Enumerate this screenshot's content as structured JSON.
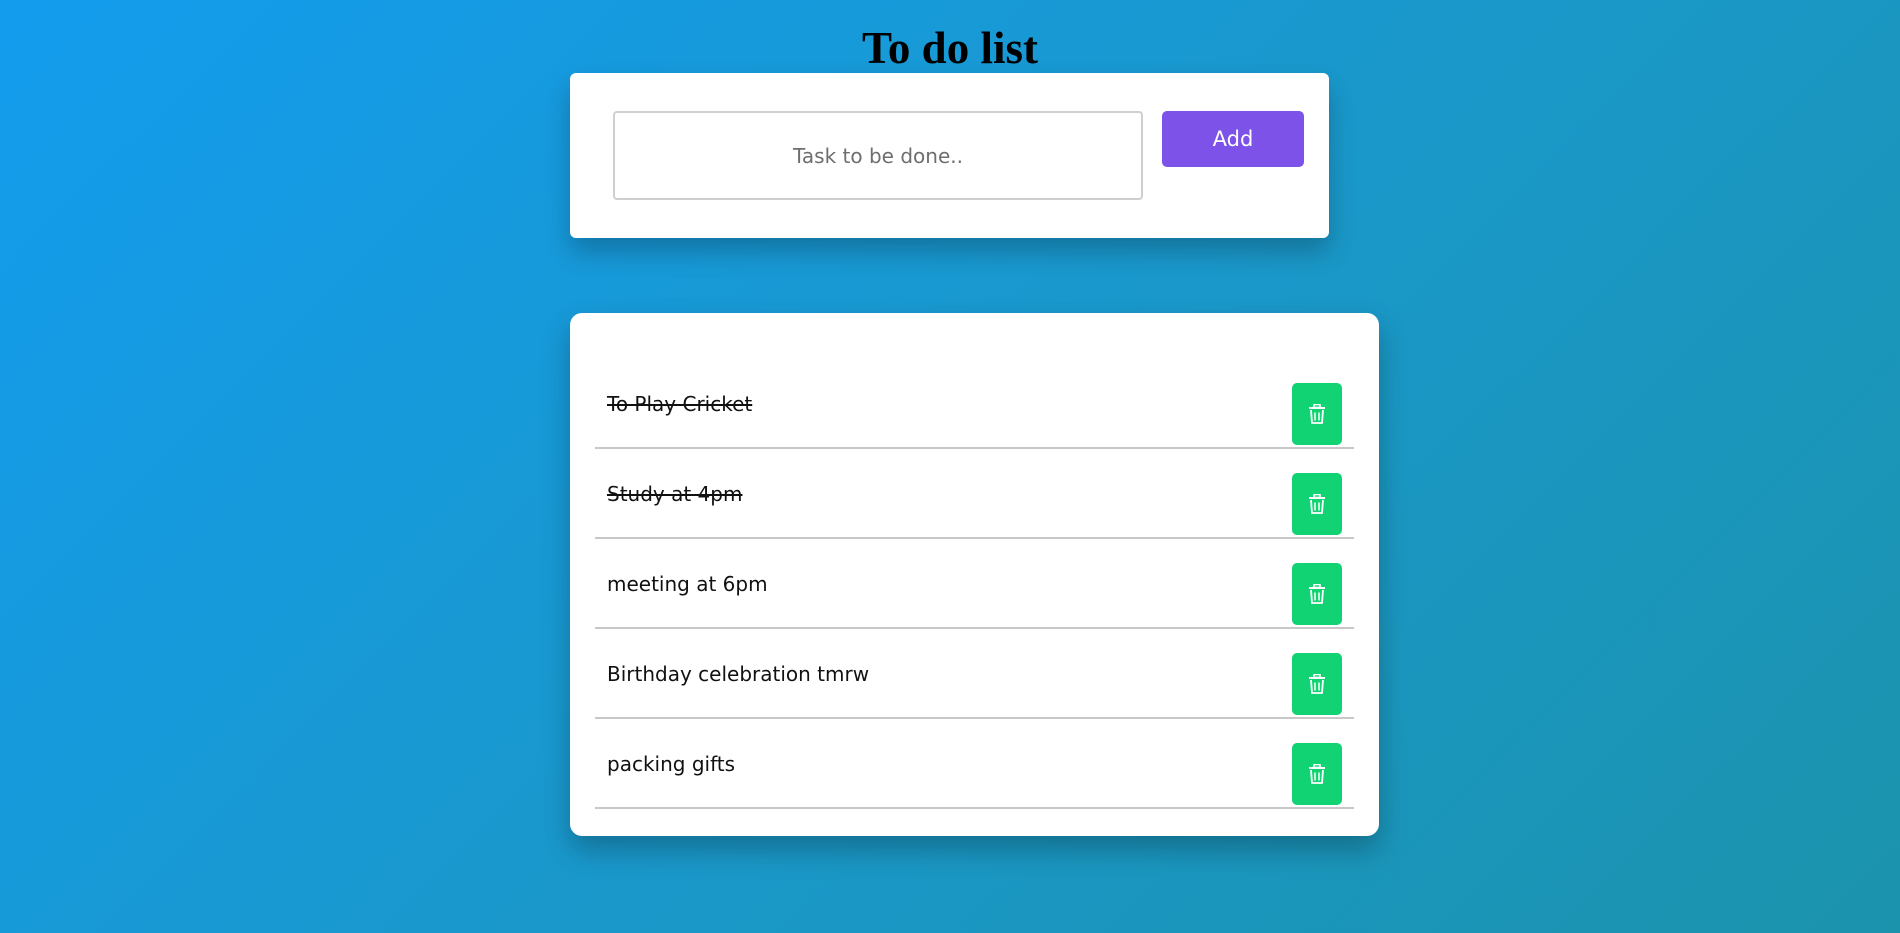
{
  "header": {
    "title": "To do list"
  },
  "input_section": {
    "placeholder": "Task to be done..",
    "value": "",
    "add_label": "Add"
  },
  "tasks": [
    {
      "text": "To Play Cricket",
      "completed": true
    },
    {
      "text": "Study at 4pm",
      "completed": true
    },
    {
      "text": "meeting at 6pm",
      "completed": false
    },
    {
      "text": "Birthday celebration tmrw",
      "completed": false
    },
    {
      "text": "packing gifts",
      "completed": false
    }
  ],
  "icons": {
    "delete": "trash-icon"
  },
  "colors": {
    "background_start": "#139cee",
    "background_end": "#1b93ad",
    "add_button": "#7c52e8",
    "delete_button": "#12d374",
    "card": "#ffffff"
  }
}
